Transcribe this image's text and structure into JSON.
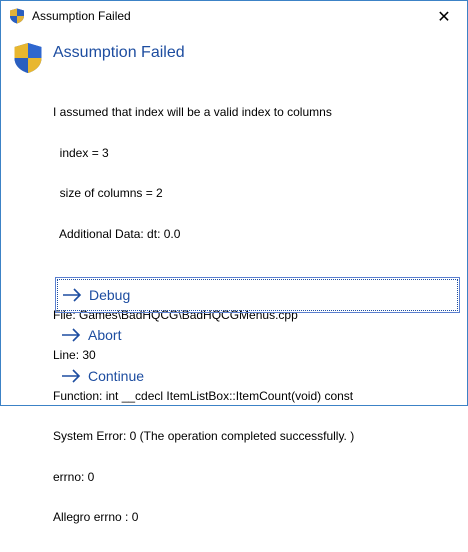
{
  "window": {
    "title": "Assumption Failed",
    "close_glyph": "✕"
  },
  "header": {
    "title": "Assumption Failed",
    "icon": "uac-shield-icon"
  },
  "message": {
    "lines": [
      "I assumed that index will be a valid index to columns",
      "  index = 3",
      "  size of columns = 2",
      "  Additional Data: dt: 0.0",
      "",
      "File: Games\\BadHQCG\\BadHQCGMenus.cpp",
      "Line: 30",
      "Function: int __cdecl ItemListBox::ItemCount(void) const",
      "System Error: 0 (The operation completed successfully. )",
      "errno: 0",
      "Allegro errno : 0"
    ]
  },
  "commands": [
    {
      "label": "Debug",
      "focused": true
    },
    {
      "label": "Abort",
      "focused": false
    },
    {
      "label": "Continue",
      "focused": false
    }
  ],
  "colors": {
    "accent": "#1d4da0",
    "border": "#3c82c6"
  }
}
